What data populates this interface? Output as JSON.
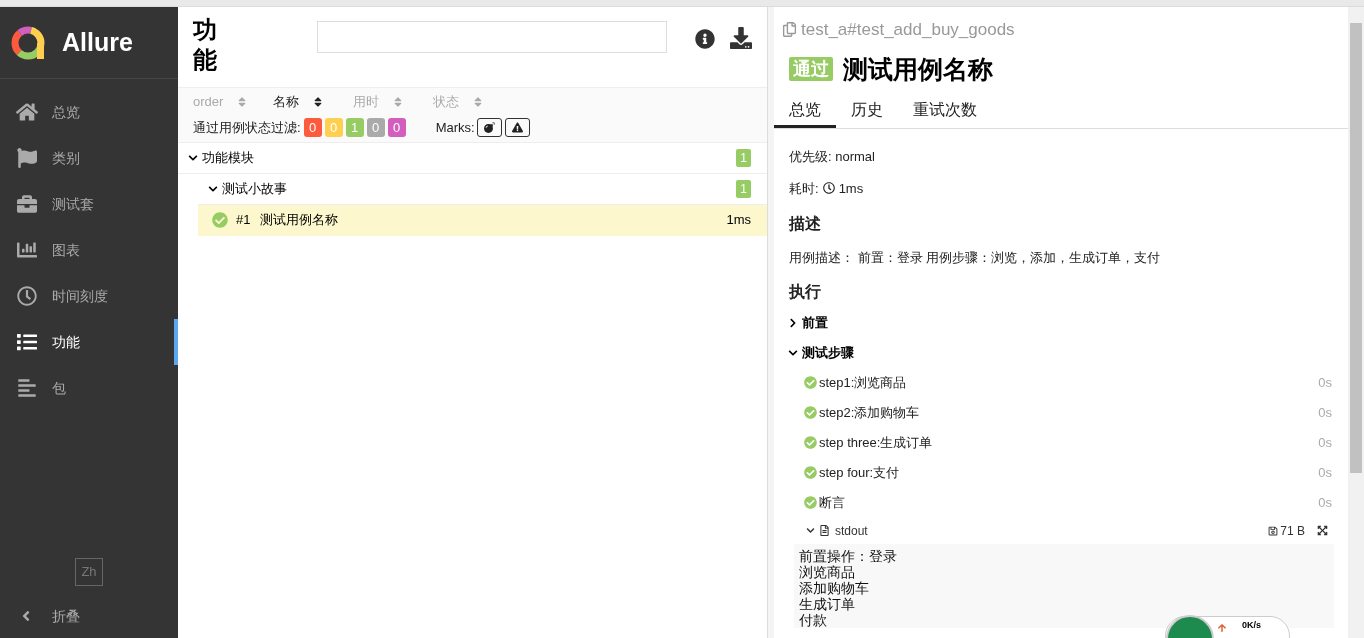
{
  "sidebar": {
    "logo": "Allure",
    "items": [
      {
        "label": "总览",
        "selected": false
      },
      {
        "label": "类别",
        "selected": false
      },
      {
        "label": "测试套",
        "selected": false
      },
      {
        "label": "图表",
        "selected": false
      },
      {
        "label": "时间刻度",
        "selected": false
      },
      {
        "label": "功能",
        "selected": true
      },
      {
        "label": "包",
        "selected": false
      }
    ],
    "language": "Zh",
    "collapse": "折叠"
  },
  "tree_panel": {
    "title": "功能",
    "sort_columns": [
      {
        "label": "order",
        "active": false
      },
      {
        "label": "名称",
        "active": true
      },
      {
        "label": "用时",
        "active": false
      },
      {
        "label": "状态",
        "active": false
      }
    ],
    "filter_label": "通过用例状态过滤:",
    "filter_counts": [
      {
        "value": "0",
        "color": "#fd5a3e"
      },
      {
        "value": "0",
        "color": "#ffd050"
      },
      {
        "value": "1",
        "color": "#97cc64"
      },
      {
        "value": "0",
        "color": "#aaaaaa"
      },
      {
        "value": "0",
        "color": "#d35ebe"
      }
    ],
    "marks_label": "Marks:",
    "tree": [
      {
        "name": "功能模块",
        "count": "1",
        "expanded": true,
        "children": [
          {
            "name": "测试小故事",
            "count": "1",
            "expanded": true,
            "cases": [
              {
                "index": "#1",
                "name": "测试用例名称",
                "duration": "1ms",
                "selected": true
              }
            ]
          }
        ]
      }
    ]
  },
  "detail": {
    "uid": "test_a#test_add_buy_goods",
    "status_label": "通过",
    "name": "测试用例名称",
    "tabs": [
      {
        "label": "总览",
        "selected": true
      },
      {
        "label": "历史",
        "selected": false
      },
      {
        "label": "重试次数",
        "selected": false
      }
    ],
    "priority": "优先级: normal",
    "duration_label": "耗时:",
    "duration": "1ms",
    "description_heading": "描述",
    "description": "用例描述： 前置：登录 用例步骤：浏览，添加，生成订单，支付",
    "execution_heading": "执行",
    "groups": [
      {
        "name": "前置",
        "expanded": false
      },
      {
        "name": "测试步骤",
        "expanded": true,
        "steps": [
          {
            "name": "step1:浏览商品",
            "duration": "0s"
          },
          {
            "name": "step2:添加购物车",
            "duration": "0s"
          },
          {
            "name": "step three:生成订单",
            "duration": "0s"
          },
          {
            "name": "step four:支付",
            "duration": "0s"
          },
          {
            "name": "断言",
            "duration": "0s"
          }
        ],
        "attachment": {
          "name": "stdout",
          "size": "71 B",
          "expanded": true,
          "lines": [
            "前置操作：登录",
            "浏览商品",
            "添加购物车",
            "生成订单",
            "付款"
          ]
        }
      }
    ]
  },
  "net_monitor": {
    "speed": "0K/s"
  }
}
